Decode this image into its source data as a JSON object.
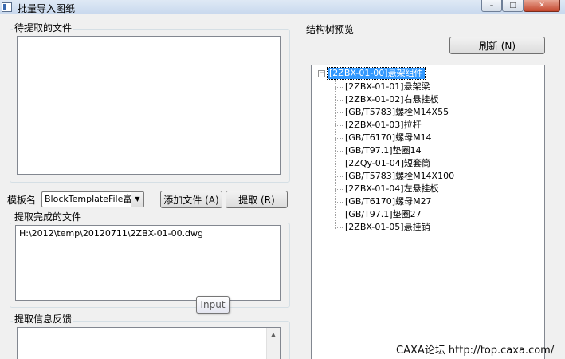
{
  "window": {
    "title": "批量导入图纸",
    "minimize_glyph": "–",
    "maximize_glyph": "□",
    "close_glyph": "✕"
  },
  "left": {
    "pending_files_label": "待提取的文件",
    "template_label": "模板名",
    "template_selected": "BlockTemplateFile富来",
    "add_file_button": "添加文件 (A)",
    "extract_button": "提取 (R)",
    "completed_files_label": "提取完成的文件",
    "completed_files": [
      "H:\\2012\\temp\\20120711\\2ZBX-01-00.dwg"
    ],
    "feedback_label": "提取信息反馈",
    "tooltip": "Input"
  },
  "right": {
    "tree_label": "结构树预览",
    "refresh_button": "刷新 (N)",
    "tree_root": "[2ZBX-01-00]悬架组件",
    "tree_items": [
      "[2ZBX-01-01]悬架梁",
      "[2ZBX-01-02]右悬挂板",
      "[GB/T5783]螺栓M14X55",
      "[2ZBX-01-03]拉杆",
      "[GB/T6170]螺母M14",
      "[GB/T97.1]垫圈14",
      "[2ZQy-01-04]短套筒",
      "[GB/T5783]螺栓M14X100",
      "[2ZBX-01-04]左悬挂板",
      "[GB/T6170]螺母M27",
      "[GB/T97.1]垫圈27",
      "[2ZBX-01-05]悬挂销"
    ]
  },
  "watermark": "CAXA论坛 http://top.caxa.com/",
  "icons": {
    "select_arrow": "▼",
    "tree_expander": "−",
    "scroll_up": "▲"
  }
}
